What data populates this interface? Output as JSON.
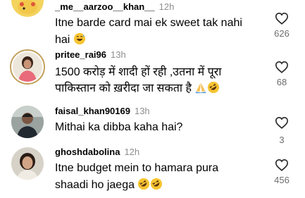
{
  "comments": [
    {
      "username": "_me__aarzoo__khan__",
      "time": "12h",
      "lines": [
        "Itne barde card mai ek sweet tak nahi",
        "hai"
      ],
      "emojis": [
        "grinning-sweat-emoji"
      ],
      "likes": "626"
    },
    {
      "username": "pritee_rai96",
      "time": "13h",
      "lines": [
        "1500 करोड़ में शादी हों रही ,उतना में पूरा",
        "पाकिस्तान को ख़रीदा जा सकता है"
      ],
      "emojis": [
        "folded-hands-emoji",
        "rofl-emoji"
      ],
      "likes": "68"
    },
    {
      "username": "faisal_khan90169",
      "time": "13h",
      "lines": [
        "Mithai ka dibba kaha hai?"
      ],
      "emojis": [],
      "likes": "3"
    },
    {
      "username": "ghoshdabolina",
      "time": "12h",
      "lines": [
        "Itne budget mein to hamara pura",
        "shaadi ho jaega"
      ],
      "emojis": [
        "rofl-emoji",
        "rofl-emoji"
      ],
      "likes": "456"
    }
  ],
  "colors": {
    "username": "#000000",
    "time": "#8e8e8e",
    "count": "#6e6e6e",
    "avatar_ring": "#c2a15b"
  }
}
